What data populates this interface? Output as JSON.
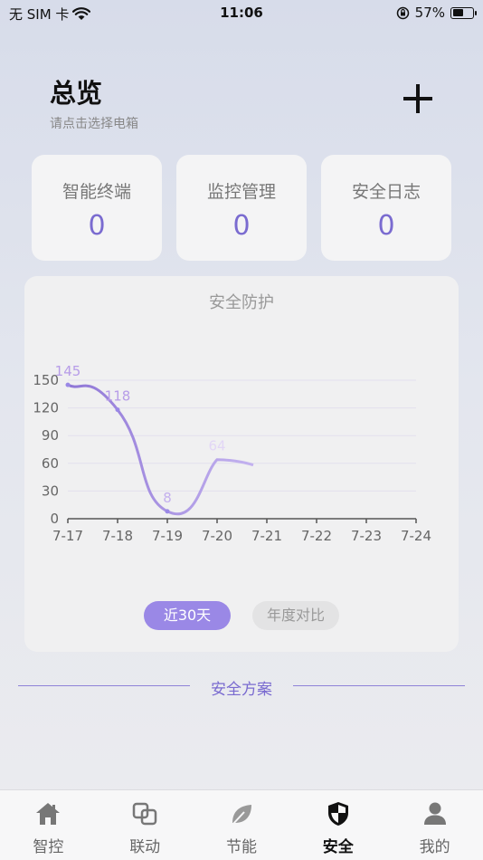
{
  "status": {
    "carrier": "无 SIM 卡",
    "time": "11:06",
    "battery": "57%",
    "battery_level": 0.57
  },
  "header": {
    "title": "总览",
    "subtitle": "请点击选择电箱"
  },
  "stats": [
    {
      "label": "智能终端",
      "value": "0"
    },
    {
      "label": "监控管理",
      "value": "0"
    },
    {
      "label": "安全日志",
      "value": "0"
    }
  ],
  "chart": {
    "title": "安全防护",
    "buttons": {
      "recent": "近30天",
      "yearly": "年度对比"
    }
  },
  "chart_data": {
    "type": "line",
    "title": "安全防护",
    "categories": [
      "7-17",
      "7-18",
      "7-19",
      "7-20",
      "7-21",
      "7-22",
      "7-23",
      "7-24"
    ],
    "series": [
      {
        "values": [
          145,
          118,
          8,
          64
        ]
      }
    ],
    "y_ticks": [
      0,
      30,
      60,
      90,
      120,
      150
    ],
    "ylim": [
      0,
      150
    ],
    "grid": true,
    "line_color": "#9a88e6"
  },
  "section": {
    "title": "安全方案"
  },
  "tabs": [
    {
      "label": "智控",
      "icon": "home-icon"
    },
    {
      "label": "联动",
      "icon": "link-icon"
    },
    {
      "label": "节能",
      "icon": "leaf-icon"
    },
    {
      "label": "安全",
      "icon": "shield-icon"
    },
    {
      "label": "我的",
      "icon": "user-icon"
    }
  ]
}
